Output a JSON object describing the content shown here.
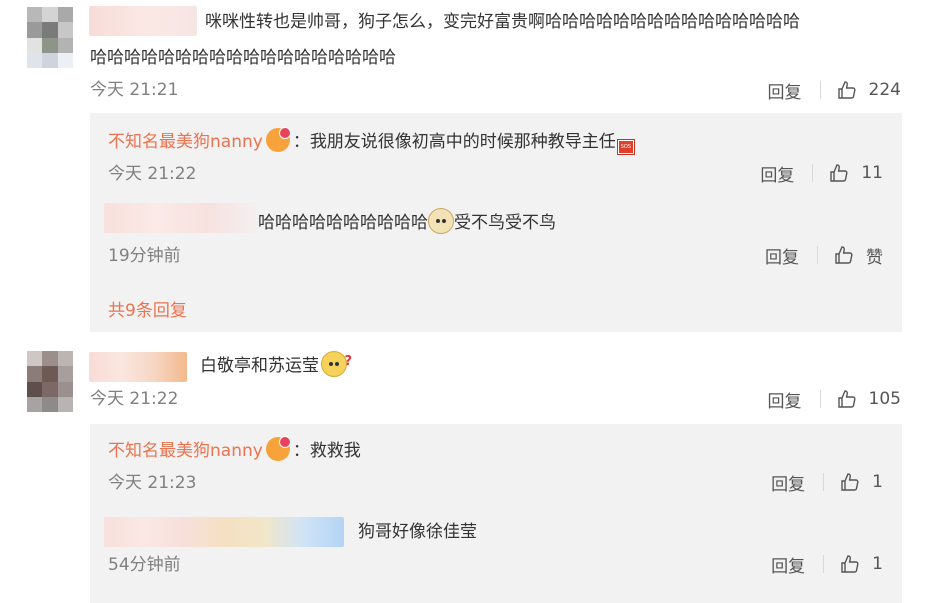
{
  "colors": {
    "accent": "#eb7350",
    "muted": "#808080",
    "reply_bg": "#f2f2f2"
  },
  "comments": [
    {
      "text_line1": "咪咪性转也是帅哥，狗子怎么，变完好富贵啊哈哈哈哈哈哈哈哈哈哈哈哈哈哈哈",
      "text_line2": "哈哈哈哈哈哈哈哈哈哈哈哈哈哈哈哈哈哈",
      "time": "今天 21:21",
      "reply_label": "回复",
      "like_count": "224",
      "replies": [
        {
          "author": "不知名最美狗nanny",
          "colon": "：",
          "text": "我朋友说很像初高中的时候那种教导主任",
          "sos_text": "SOS",
          "time": "今天 21:22",
          "reply_label": "回复",
          "like_count": "11"
        },
        {
          "text_before": "哈哈哈哈哈哈哈哈哈哈",
          "text_after": "受不鸟受不鸟",
          "time": "19分钟前",
          "reply_label": "回复",
          "like_count": "赞"
        }
      ],
      "more_label": "共9条回复"
    },
    {
      "text": "白敬亭和苏运莹",
      "time": "今天 21:22",
      "reply_label": "回复",
      "like_count": "105",
      "replies": [
        {
          "author": "不知名最美狗nanny",
          "colon": "：",
          "text": "救救我",
          "time": "今天 21:23",
          "reply_label": "回复",
          "like_count": "1"
        },
        {
          "text": "狗哥好像徐佳莹",
          "time": "54分钟前",
          "reply_label": "回复",
          "like_count": "1"
        }
      ]
    }
  ]
}
